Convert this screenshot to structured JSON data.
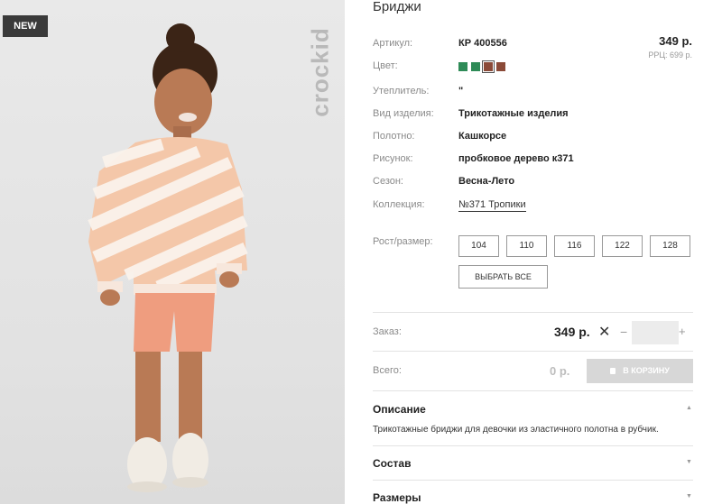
{
  "badge": "NEW",
  "watermark": "crockid",
  "product": {
    "title": "Бриджи",
    "price": "349 р.",
    "rrp": "РРЦ: 699 р."
  },
  "specs": [
    {
      "label": "Артикул:",
      "value": "КР 400556"
    },
    {
      "label": "Цвет:",
      "value": ""
    },
    {
      "label": "Утеплитель:",
      "value": "\""
    },
    {
      "label": "Вид изделия:",
      "value": "Трикотажные изделия"
    },
    {
      "label": "Полотно:",
      "value": "Кашкорсе"
    },
    {
      "label": "Рисунок:",
      "value": "пробковое дерево к371"
    },
    {
      "label": "Сезон:",
      "value": "Весна-Лето"
    },
    {
      "label": "Коллекция:",
      "value": "№371 Тропики"
    }
  ],
  "colors": [
    "#2e8b57",
    "#2e8b57",
    "#8b4a38",
    "#8b4a38"
  ],
  "selected_color_index": 2,
  "size": {
    "label": "Рост/размер:",
    "options": [
      "104",
      "110",
      "116",
      "122",
      "128"
    ],
    "select_all": "ВЫБРАТЬ ВСЕ"
  },
  "order": {
    "label": "Заказ:",
    "price": "349 р.",
    "times": "✕",
    "minus": "−",
    "plus": "+",
    "quantity": ""
  },
  "total": {
    "label": "Всего:",
    "value": "0 р.",
    "cart_button": "В КОРЗИНУ"
  },
  "accordion": {
    "description_title": "Описание",
    "description_text": "Трикотажные бриджи для девочки из эластичного полотна в рубчик.",
    "composition_title": "Состав",
    "sizes_title": "Размеры",
    "arrow_up": "▲",
    "arrow_down": "▼"
  }
}
